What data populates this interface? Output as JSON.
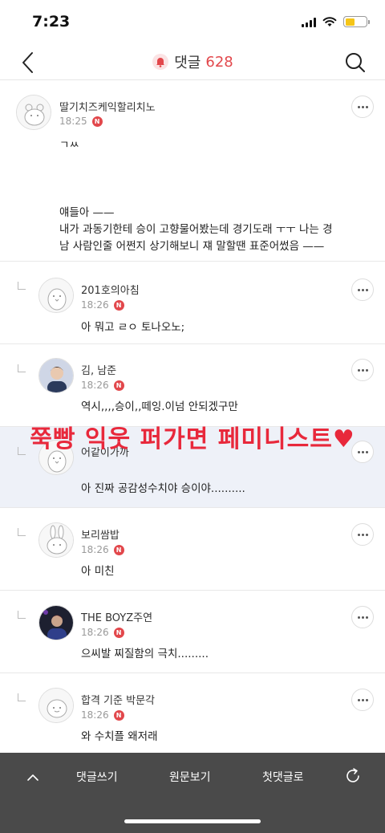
{
  "status_bar": {
    "time": "7:23"
  },
  "header": {
    "title": "댓글",
    "count": "628"
  },
  "comments": [
    {
      "nickname": "딸기치즈케익할리치노",
      "time": "18:25",
      "badge": "N",
      "lines": [
        "ㄱㅆ",
        "",
        "",
        "",
        "얘들아 ——",
        "내가 과동기한테 승이 고향물어봤는데 경기도래 ㅜㅜ 나는 경",
        "남 사람인줄 어쩐지 상기해보니 쟤 말할땐 표준어썼음 ——"
      ]
    },
    {
      "nickname": "201호의아침",
      "time": "18:26",
      "badge": "N",
      "text": "아 뭐고 ㄹㅇ 토나오노;"
    },
    {
      "nickname": "김, 남준",
      "time": "18:26",
      "badge": "N",
      "text": "역시,,,,승이,,떼잉.이넘 안되겠구만"
    },
    {
      "nickname": "어같이가까",
      "time": "18:26",
      "badge": "N",
      "text": "아 진짜 공감성수치야 승이야.........."
    },
    {
      "nickname": "보리쌈밥",
      "time": "18:26",
      "badge": "N",
      "text": "아 미친"
    },
    {
      "nickname": "THE BOYZ주연",
      "time": "18:26",
      "badge": "N",
      "text": "으씨발 찌질함의 극치........."
    },
    {
      "nickname": "합격 기준 박문각",
      "time": "18:26",
      "badge": "N",
      "text": "와 수치플 왜저래"
    }
  ],
  "overlay": {
    "caption": "쭉빵 익웃 퍼가면 페미니스트",
    "heart": "♥"
  },
  "bottom_bar": {
    "write": "댓글쓰기",
    "original": "원문보기",
    "first": "첫댓글로"
  },
  "colors": {
    "accent": "#e2474b",
    "bottom_bar": "#4a4a4a",
    "highlight_row": "#eef1f8"
  },
  "icons": {
    "back": "chevron-left-icon",
    "bell": "bell-icon",
    "search": "search-icon",
    "more": "more-icon",
    "up": "chevron-up-icon",
    "refresh": "refresh-icon"
  }
}
